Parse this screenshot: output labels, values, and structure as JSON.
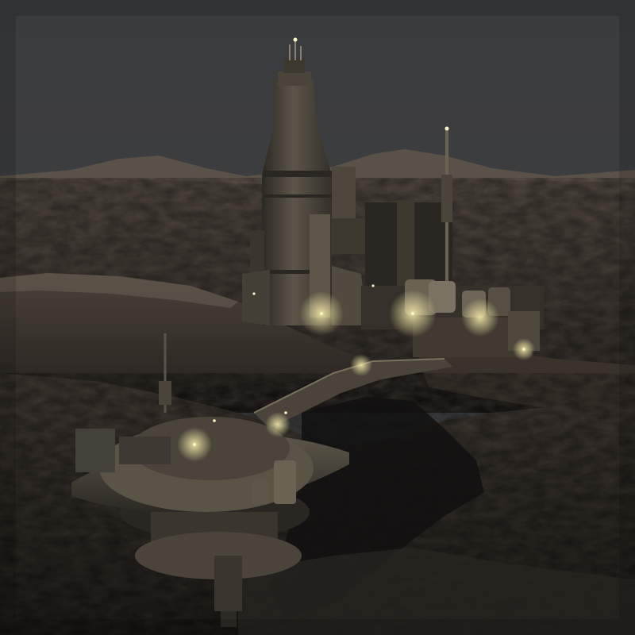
{
  "scene": {
    "subject": "canyon-fortress-render",
    "colors": {
      "sky": "#3c3d3f",
      "rock_dark": "#1c1a17",
      "rock_mid": "#3d3630",
      "rock_light": "#5a5046",
      "metal_dark": "#2a2722",
      "metal_mid": "#4a443a",
      "metal_light": "#6e6656",
      "glow": "#f4e9a8",
      "lamp": "#fff6c8"
    }
  }
}
